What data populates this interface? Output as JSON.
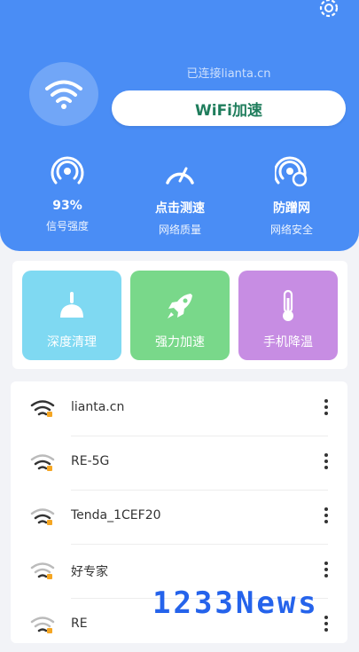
{
  "header": {
    "status_text": "已连接lianta.cn",
    "boost_label": "WiFi加速",
    "stats": [
      {
        "value": "93%",
        "label": "信号强度",
        "icon": "signal-icon"
      },
      {
        "value": "点击测速",
        "label": "网络质量",
        "icon": "speedometer-icon"
      },
      {
        "value": "防蹭网",
        "label": "网络安全",
        "icon": "shield-wifi-icon"
      }
    ]
  },
  "tools": [
    {
      "label": "深度清理",
      "icon": "broom-icon",
      "color": "#7fd9f2"
    },
    {
      "label": "强力加速",
      "icon": "rocket-icon",
      "color": "#79d88a"
    },
    {
      "label": "手机降温",
      "icon": "thermometer-icon",
      "color": "#c78de3"
    }
  ],
  "networks": [
    {
      "name": "lianta.cn"
    },
    {
      "name": "RE-5G"
    },
    {
      "name": "Tenda_1CEF20"
    },
    {
      "name": "好专家"
    },
    {
      "name": "RE"
    }
  ],
  "watermark": "1233News",
  "colors": {
    "header_blue": "#4a8df5",
    "boost_text": "#1f7d5c",
    "lock_orange": "#f5a623"
  }
}
